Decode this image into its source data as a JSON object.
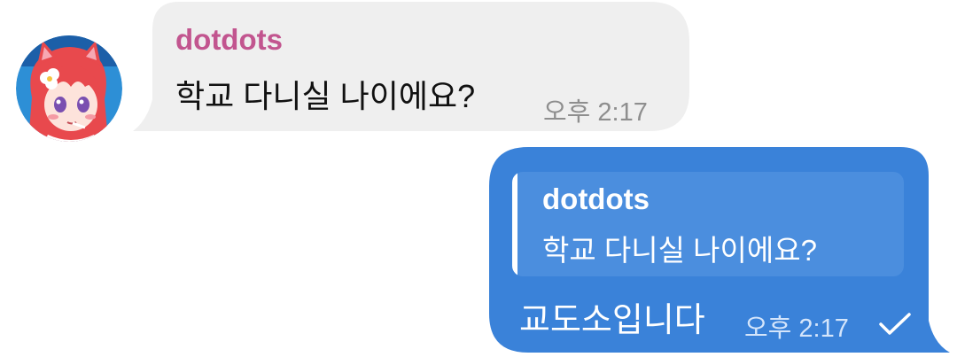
{
  "incoming": {
    "sender": "dotdots",
    "text": "학교 다니실 나이에요?",
    "time": "오후 2:17",
    "avatar_icon": "anime-cat-girl-avatar"
  },
  "outgoing": {
    "reply": {
      "sender": "dotdots",
      "text": "학교 다니실 나이에요?"
    },
    "text": "교도소입니다",
    "time": "오후 2:17",
    "status_icon": "check-icon"
  },
  "colors": {
    "incoming_bubble": "#efefef",
    "incoming_sender": "#c2558f",
    "outgoing_bubble": "#3a82d9",
    "reply_background": "#4b8ede",
    "page_background": "#ffffff"
  }
}
